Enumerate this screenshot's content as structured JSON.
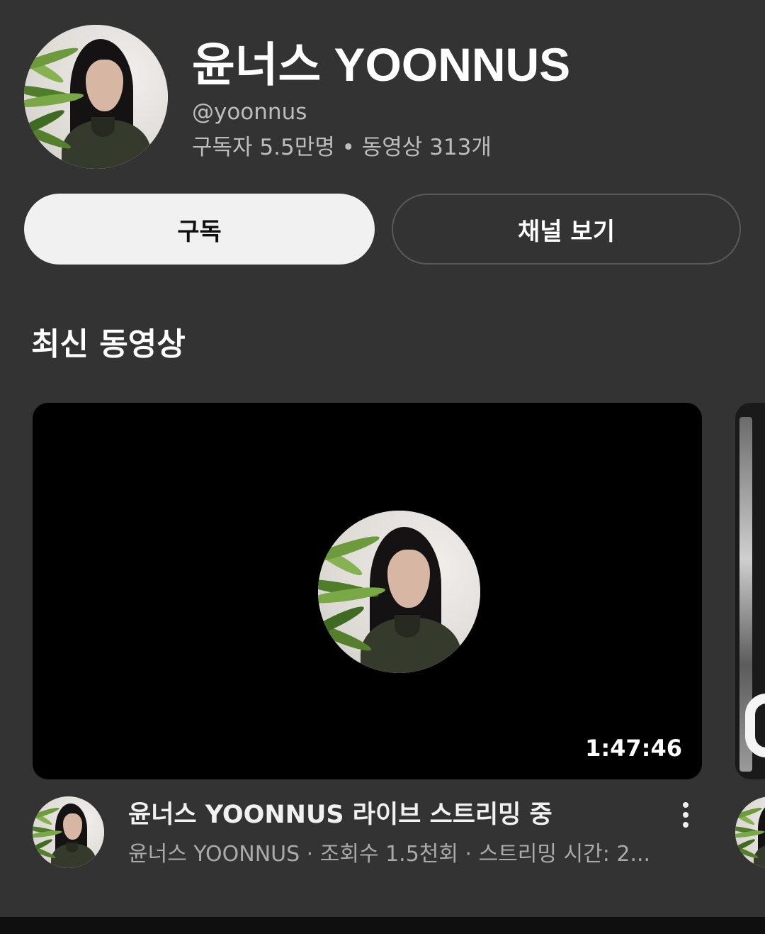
{
  "channel": {
    "name": "윤너스 YOONNUS",
    "handle": "@yoonnus",
    "stats": "구독자 5.5만명 • 동영상 313개"
  },
  "buttons": {
    "subscribe": "구독",
    "view_channel": "채널 보기"
  },
  "section": {
    "title": "최신 동영상"
  },
  "video": {
    "duration": "1:47:46",
    "title": "윤너스 YOONNUS 라이브 스트리밍 중",
    "meta": "윤너스 YOONNUS · 조회수 1.5천회 · 스트리밍 시간: 2..."
  },
  "icons": {
    "more": "more-vert-icon"
  },
  "colors": {
    "background": "#333333",
    "subscribe_button": "#f1f1f1",
    "thumbnail": "#000000"
  }
}
